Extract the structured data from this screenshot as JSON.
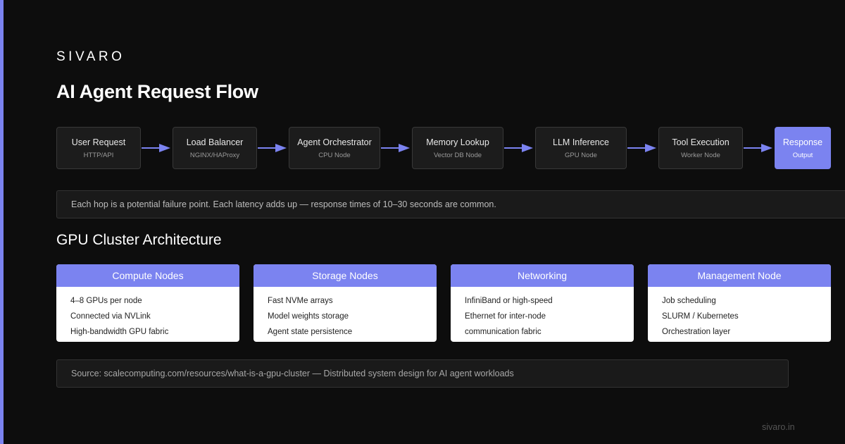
{
  "brand": "SIVARO",
  "title": "AI Agent Request Flow",
  "flow": [
    {
      "name": "User Request",
      "sub": "HTTP/API"
    },
    {
      "name": "Load Balancer",
      "sub": "NGINX/HAProxy"
    },
    {
      "name": "Agent Orchestrator",
      "sub": "CPU Node"
    },
    {
      "name": "Memory Lookup",
      "sub": "Vector DB Node"
    },
    {
      "name": "LLM Inference",
      "sub": "GPU Node"
    },
    {
      "name": "Tool Execution",
      "sub": "Worker Node"
    },
    {
      "name": "Response",
      "sub": "Output"
    }
  ],
  "note": "Each hop is a potential failure point. Each latency adds up — response times of 10–30 seconds are common.",
  "section_title": "GPU Cluster Architecture",
  "cards": [
    {
      "title": "Compute Nodes",
      "items": [
        "4–8 GPUs per node",
        "Connected via NVLink",
        "High-bandwidth GPU fabric"
      ]
    },
    {
      "title": "Storage Nodes",
      "items": [
        "Fast NVMe arrays",
        "Model weights storage",
        "Agent state persistence"
      ]
    },
    {
      "title": "Networking",
      "items": [
        "InfiniBand or high-speed",
        "Ethernet for inter-node",
        "communication fabric"
      ]
    },
    {
      "title": "Management Node",
      "items": [
        "Job scheduling",
        "SLURM / Kubernetes",
        "Orchestration layer"
      ]
    }
  ],
  "source": "Source: scalecomputing.com/resources/what-is-a-gpu-cluster — Distributed system design for AI agent workloads",
  "footer_url": "sivaro.in",
  "colors": {
    "accent": "#7b83f0",
    "background": "#0d0d0d",
    "box": "#1c1c1c",
    "card": "#ffffff"
  }
}
